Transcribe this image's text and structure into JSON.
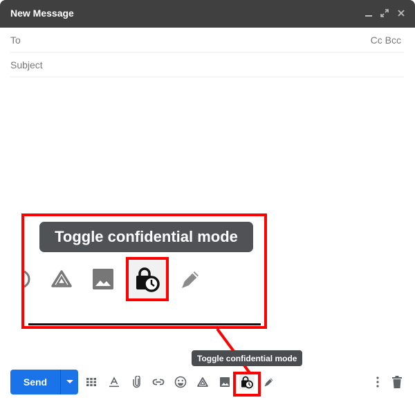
{
  "window": {
    "title": "New Message",
    "controls": [
      {
        "name": "minimize-icon",
        "glyph": "_"
      },
      {
        "name": "expand-icon",
        "glyph": "⤢"
      },
      {
        "name": "close-icon",
        "glyph": "✕"
      }
    ]
  },
  "fields": {
    "to": {
      "label": "To",
      "value": ""
    },
    "cc_label": "Cc",
    "bcc_label": "Bcc",
    "subject": {
      "label": "Subject",
      "value": ""
    }
  },
  "body": {
    "value": ""
  },
  "toolbar": {
    "send_label": "Send",
    "send_options_icon": "arrow-drop-down-icon",
    "icons": [
      {
        "name": "formatting-options-icon",
        "tooltip": ""
      },
      {
        "name": "text-format-icon",
        "tooltip": ""
      },
      {
        "name": "attach-files-icon",
        "tooltip": ""
      },
      {
        "name": "insert-link-icon",
        "tooltip": ""
      },
      {
        "name": "insert-emoji-icon",
        "tooltip": ""
      },
      {
        "name": "google-drive-icon",
        "tooltip": ""
      },
      {
        "name": "insert-photo-icon",
        "tooltip": ""
      },
      {
        "name": "confidential-mode-icon",
        "tooltip": "Toggle confidential mode",
        "active": true
      },
      {
        "name": "signature-pen-icon",
        "tooltip": ""
      }
    ],
    "more_options_icon": "more-vert-icon",
    "discard_icon": "trash-icon"
  },
  "tooltip": {
    "text": "Toggle confidential mode"
  },
  "callout": {
    "tooltip_text": "Toggle confidential mode",
    "highlight_color": "#ff0000"
  },
  "colors": {
    "titlebar": "#404040",
    "send_button": "#1a73e8",
    "tooltip_bg": "#4a4d50",
    "annotation": "#ff0000"
  }
}
